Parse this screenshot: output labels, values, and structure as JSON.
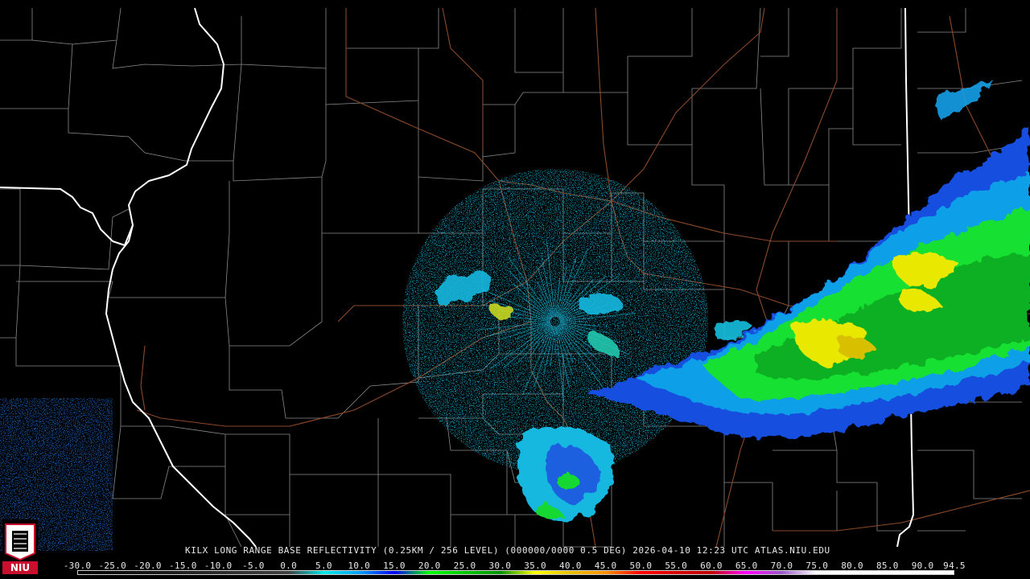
{
  "product": {
    "radar_id": "KILX",
    "product_name": "LONG RANGE BASE REFLECTIVITY",
    "resolution": "(0.25KM / 256 LEVEL)",
    "volume": "(000000/0000 0.5 DEG)",
    "timestamp": "2026-04-10 12:23 UTC",
    "site": "ATLAS.NIU.EDU"
  },
  "logo": {
    "text": "NIU",
    "color": "#c8102e"
  },
  "colorbar": {
    "labels": [
      "-30.0",
      "-25.0",
      "-20.0",
      "-15.0",
      "-10.0",
      "-5.0",
      "0.0",
      "5.0",
      "10.0",
      "15.0",
      "20.0",
      "25.0",
      "30.0",
      "35.0",
      "40.0",
      "45.0",
      "50.0",
      "55.0",
      "60.0",
      "65.0",
      "70.0",
      "75.0",
      "80.0",
      "85.0",
      "90.0",
      "94.5"
    ],
    "min": -30,
    "max": 94.5,
    "stops": [
      {
        "dbz": -30,
        "color": "#000000"
      },
      {
        "dbz": 0,
        "color": "#404040"
      },
      {
        "dbz": 5,
        "color": "#00e8e8"
      },
      {
        "dbz": 10,
        "color": "#01a0f6"
      },
      {
        "dbz": 15,
        "color": "#0000f6"
      },
      {
        "dbz": 20,
        "color": "#00ff00"
      },
      {
        "dbz": 25,
        "color": "#00c800"
      },
      {
        "dbz": 30,
        "color": "#009000"
      },
      {
        "dbz": 35,
        "color": "#ffff00"
      },
      {
        "dbz": 40,
        "color": "#e7c000"
      },
      {
        "dbz": 45,
        "color": "#ff9000"
      },
      {
        "dbz": 50,
        "color": "#ff0000"
      },
      {
        "dbz": 55,
        "color": "#d60000"
      },
      {
        "dbz": 60,
        "color": "#c00000"
      },
      {
        "dbz": 65,
        "color": "#ff00ff"
      },
      {
        "dbz": 70,
        "color": "#9955c9"
      },
      {
        "dbz": 75,
        "color": "#ffffff"
      },
      {
        "dbz": 94.5,
        "color": "#ffffff"
      }
    ]
  },
  "colors": {
    "background": "#000000",
    "county_lines": "#8a8a8a",
    "state_lines": "#ffffff",
    "highways": "#8b4a2b"
  }
}
